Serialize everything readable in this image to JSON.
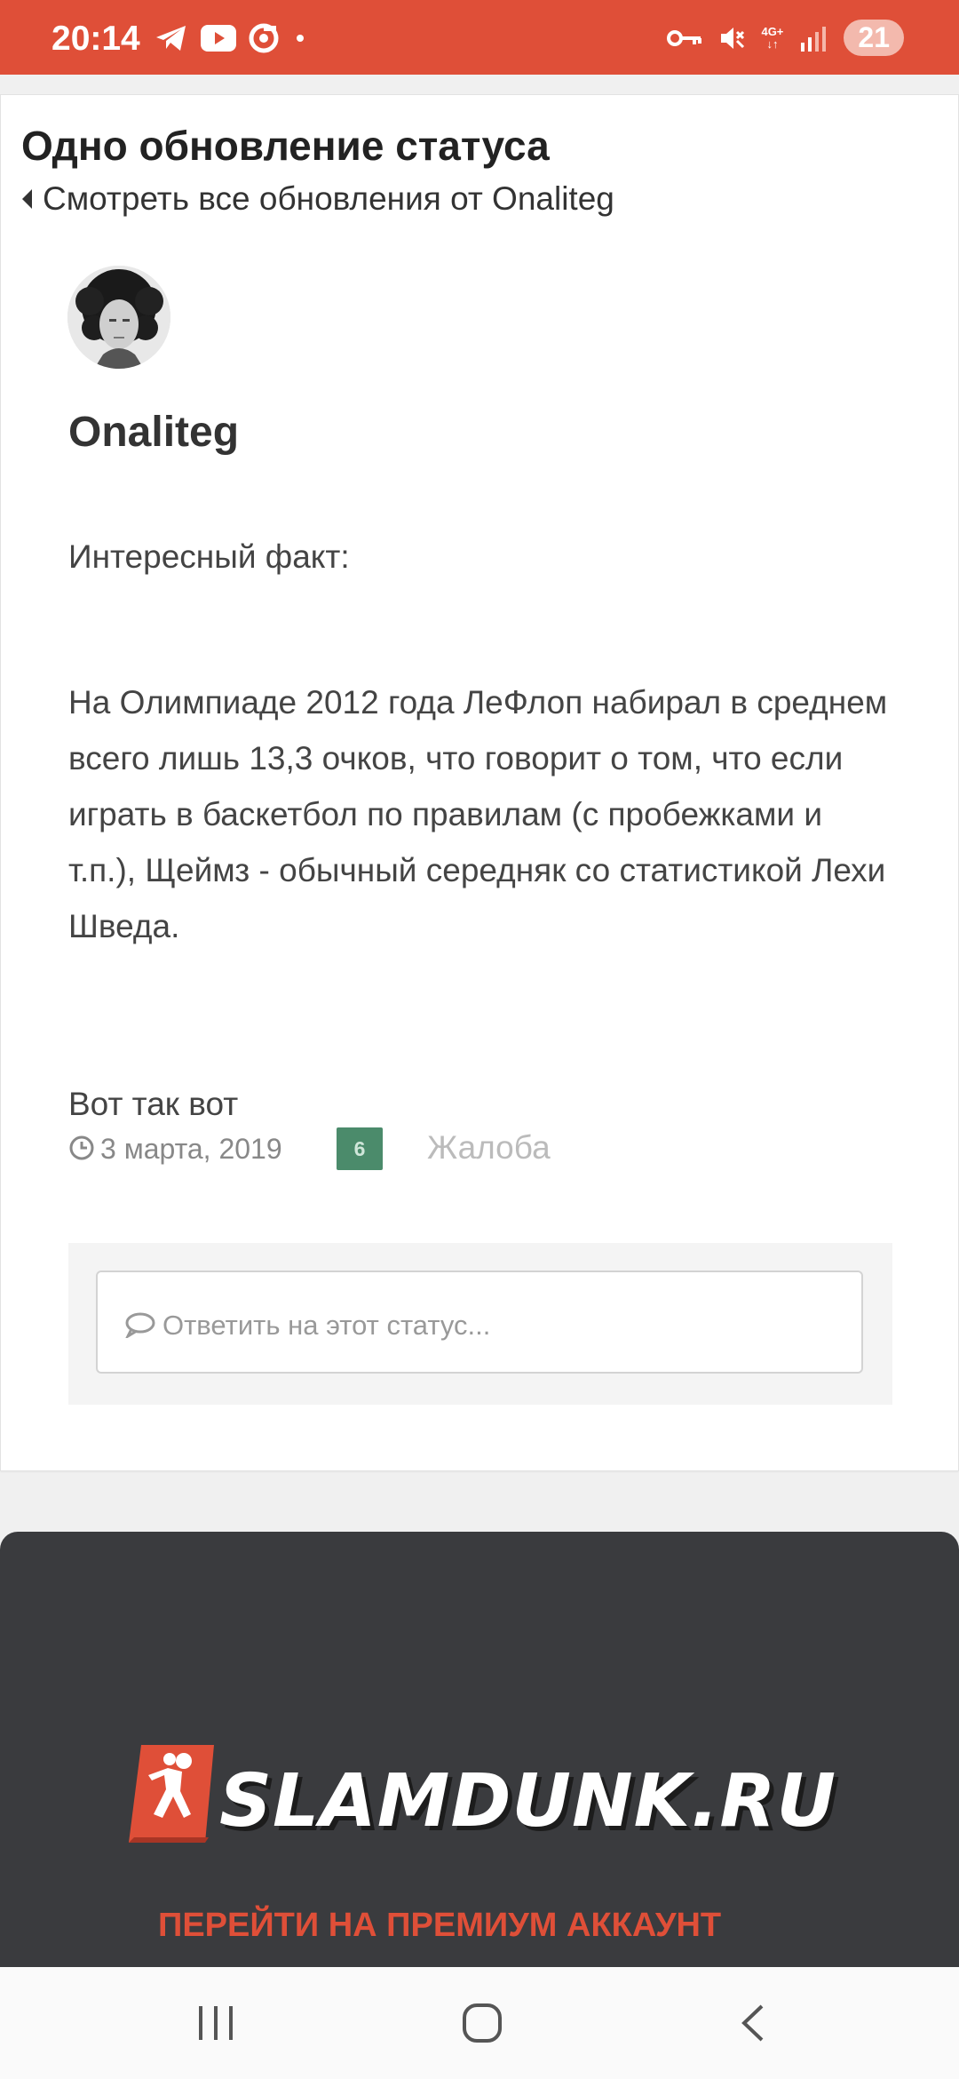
{
  "status_bar": {
    "time": "20:14",
    "left_icons": [
      "telegram-icon",
      "youtube-icon",
      "app-icon",
      "dot-icon"
    ],
    "right_icons": [
      "vpn-key-icon",
      "mute-icon",
      "network-4g-icon",
      "signal-icon"
    ],
    "network_label": "4G+",
    "battery": "21"
  },
  "page": {
    "title": "Одно обновление статуса",
    "back_link": "Смотреть все обновления от Onaliteg"
  },
  "status": {
    "author": "Onaliteg",
    "paragraphs": [
      "Интересный факт:",
      "На Олимпиаде 2012 года ЛеФлоп набирал в среднем всего лишь 13,3 очков, что говорит о том, что если играть в баскетбол по правилам (с пробежками и т.п.), Щеймз - обычный середняк со статистикой Лехи Шведа.",
      "Вот так вот"
    ],
    "date": "3 марта, 2019",
    "reputation": "6",
    "report_label": "Жалоба",
    "reply_placeholder": "Ответить на этот статус..."
  },
  "footer": {
    "logo_text": "SLAMDUNK.RU",
    "premium_link": "ПЕРЕЙТИ НА ПРЕМИУМ АККАУНТ"
  },
  "colors": {
    "accent": "#df4f38",
    "reputation_green": "#4b8b6b",
    "footer_bg": "#3a3b3e"
  }
}
